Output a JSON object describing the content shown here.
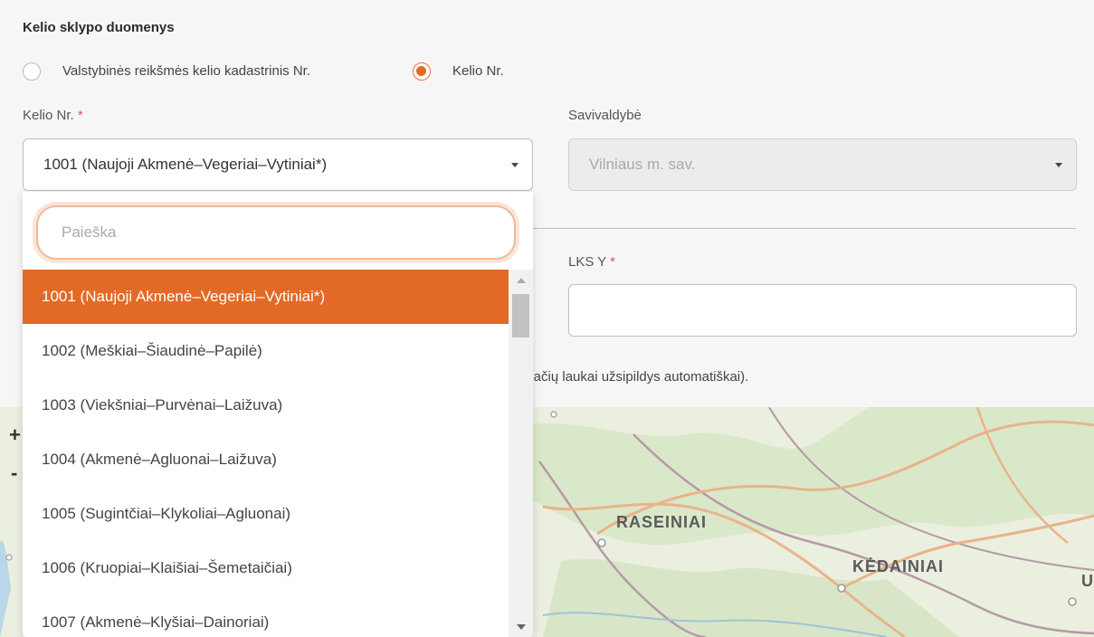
{
  "form": {
    "section_title": "Kelio sklypo duomenys",
    "radio_options": [
      {
        "label": "Valstybinės reikšmės kelio kadastrinis Nr.",
        "checked": false
      },
      {
        "label": "Kelio Nr.",
        "checked": true
      }
    ],
    "road_no_label": "Kelio Nr.",
    "required_mark": "*",
    "road_no_value": "1001 (Naujoji Akmenė–Vegeriai–Vytiniai*)",
    "municipality_label": "Savivaldybė",
    "municipality_value": "Vilniaus m. sav.",
    "lks_y_label": "LKS Y",
    "hint_text": "inačių laukai užsipildys automatiškai)."
  },
  "dropdown": {
    "search_placeholder": "Paieška",
    "items": [
      "1001 (Naujoji Akmenė–Vegeriai–Vytiniai*)",
      "1002 (Meškiai–Šiaudinė–Papilė)",
      "1003 (Viekšniai–Purvėnai–Laižuva)",
      "1004 (Akmenė–Agluonai–Laižuva)",
      "1005 (Sugintčiai–Klykoliai–Agluonai)",
      "1006 (Kruopiai–Klaišiai–Šemetaičiai)",
      "1007 (Akmenė–Klyšiai–Dainoriai)"
    ],
    "selected_index": 0
  },
  "map": {
    "labels": [
      "RASEINIAI",
      "KĖDAINIAI",
      "U"
    ],
    "zoom_in": "+",
    "zoom_out": "-"
  },
  "colors": {
    "accent": "#e36a26",
    "required": "#e2574c"
  }
}
